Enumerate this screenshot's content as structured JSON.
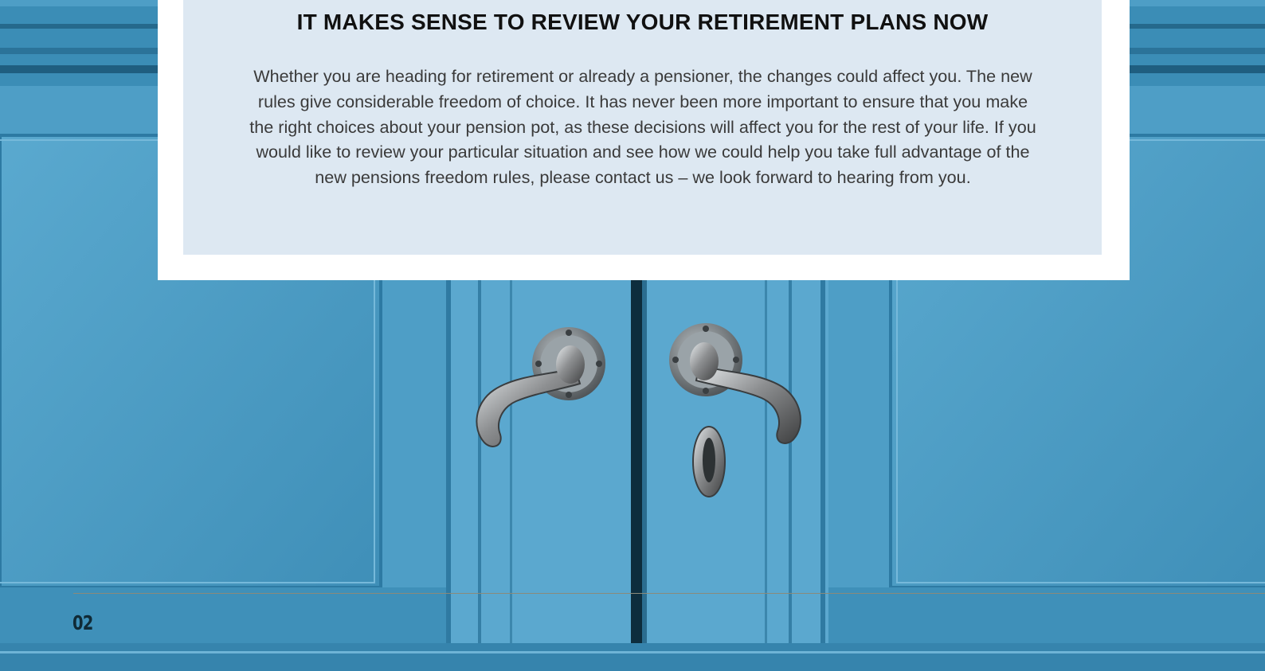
{
  "section": {
    "title": "IT MAKES SENSE TO REVIEW YOUR RETIREMENT PLANS NOW",
    "body": "Whether you are heading for retirement or already a pensioner, the changes could affect you. The new rules give considerable freedom of choice. It has never been more important to ensure that you make the right choices about your pension pot, as these decisions will affect you for the rest of your life. If you would like to review your particular situation and see how we could help you take full advantage of the new pensions freedom rules, please contact us – we look forward to hearing from you."
  },
  "footer": {
    "page_number": "02"
  },
  "colors": {
    "door_blue": "#4f9fc6",
    "card_panel": "#dde8f2",
    "card_border": "#ffffff",
    "title_text": "#111111",
    "body_text": "#3a3a3a"
  },
  "image": {
    "subject": "blue-double-doors-photo"
  }
}
